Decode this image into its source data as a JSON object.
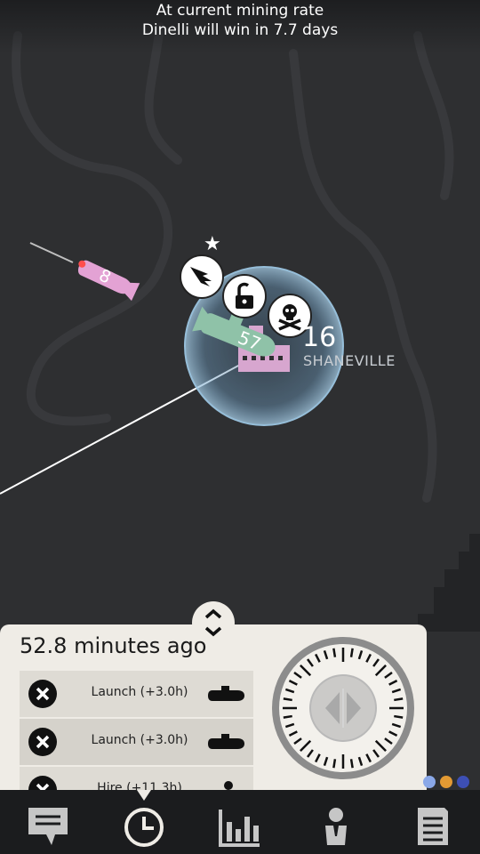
{
  "banner": {
    "line1": "At current mining rate",
    "line2": "Dinelli will win in 7.7 days"
  },
  "map": {
    "enemy_sub_count": "8",
    "player_sub_count": "57",
    "city": {
      "name": "SHANEVILLE",
      "count": "16",
      "icons": [
        "wing-icon",
        "unlock-icon",
        "skull-crossbones-icon"
      ]
    },
    "colors": {
      "enemy_sub": "#e3a2d4",
      "player_sub": "#8fc2a8",
      "city": "#d7a6cf",
      "dome": "#8ab8d8"
    }
  },
  "panel": {
    "time_ago": "52.8 minutes ago",
    "actions": [
      {
        "label": "Launch (+3.0h)",
        "type_icon": "submarine-icon"
      },
      {
        "label": "Launch (+3.0h)",
        "type_icon": "submarine-icon"
      },
      {
        "label": "Hire (+11.3h)",
        "type_icon": "person-icon"
      }
    ]
  },
  "player_dots": [
    "#8aa8e8",
    "#e39a33",
    "#3d4fb4"
  ],
  "nav": {
    "items": [
      "chat-icon",
      "clock-icon",
      "bar-chart-icon",
      "agent-icon",
      "document-icon"
    ],
    "active": "clock-icon"
  }
}
